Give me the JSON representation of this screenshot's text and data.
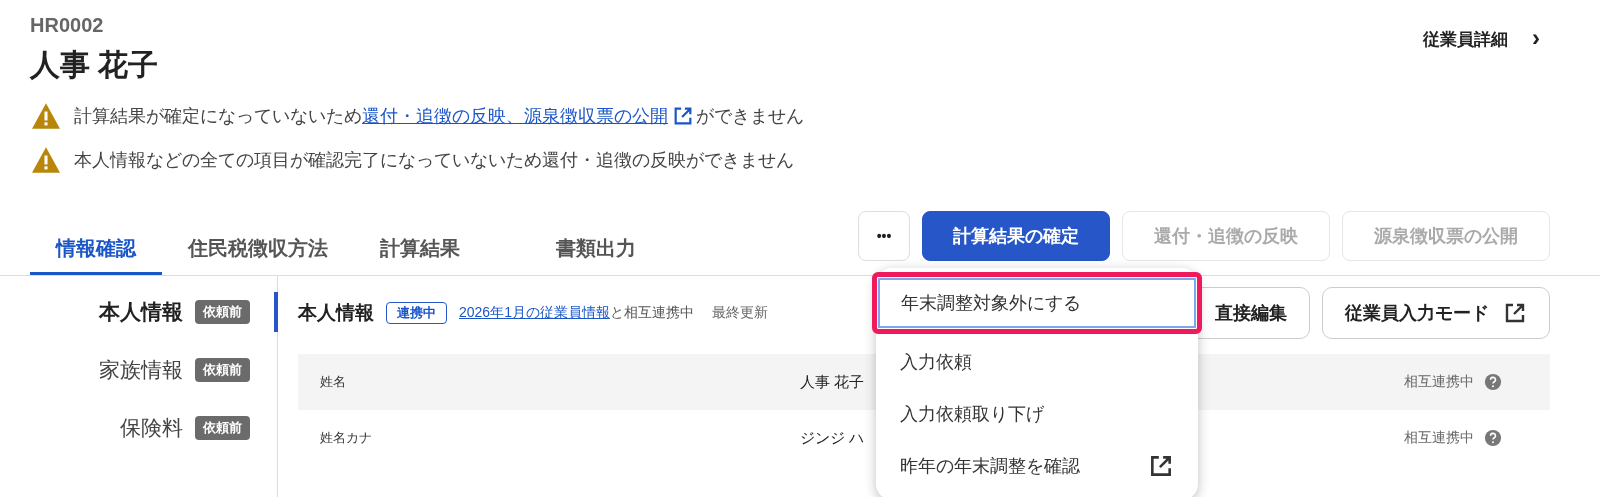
{
  "employee": {
    "code": "HR0002",
    "name": "人事 花子"
  },
  "detail_link": {
    "label": "従業員詳細",
    "arrow": "›"
  },
  "warnings": [
    {
      "before": "計算結果が確定になっていないため",
      "link": "還付・追徴の反映、源泉徴収票の公開",
      "after": "ができません"
    },
    {
      "before": "本人情報などの全ての項目が確認完了になっていないため還付・追徴の反映ができません"
    }
  ],
  "tabs": [
    {
      "label": "情報確認",
      "selected": true
    },
    {
      "label": "住民税徴収方法",
      "selected": false
    },
    {
      "label": "計算結果",
      "selected": false
    },
    {
      "label": "書類出力",
      "selected": false
    }
  ],
  "actions": [
    {
      "label": "•••",
      "kind": "more",
      "disabled": false
    },
    {
      "label": "計算結果の確定",
      "kind": "primary",
      "disabled": false
    },
    {
      "label": "還付・追徴の反映",
      "kind": "secondary",
      "disabled": true
    },
    {
      "label": "源泉徴収票の公開",
      "kind": "secondary",
      "disabled": true
    }
  ],
  "menu": {
    "items": [
      {
        "label": "年末調整対象外にする",
        "highlighted": true,
        "external": false
      },
      {
        "label": "入力依頼",
        "highlighted": false,
        "external": false
      },
      {
        "label": "入力依頼取り下げ",
        "highlighted": false,
        "external": false
      },
      {
        "label": "昨年の年末調整を確認",
        "highlighted": false,
        "external": true
      }
    ]
  },
  "sidebar": {
    "items": [
      {
        "label": "本人情報",
        "badge": "依頼前",
        "selected": true
      },
      {
        "label": "家族情報",
        "badge": "依頼前",
        "selected": false
      },
      {
        "label": "保険料",
        "badge": "依頼前",
        "selected": false
      }
    ]
  },
  "section": {
    "title": "本人情報",
    "status": "連携中",
    "link": "2026年1月の従業員情報",
    "link_suffix": "と相互連携中",
    "updated": "最終更新",
    "buttons": [
      {
        "label": "直接編集",
        "external": false
      },
      {
        "label": "従業員入力モード",
        "external": true
      }
    ]
  },
  "table": {
    "rows": [
      {
        "label": "姓名",
        "value": "人事 花子",
        "status": "相互連携中"
      },
      {
        "label": "姓名カナ",
        "value": "ジンジ ハ",
        "status": "相互連携中"
      }
    ]
  }
}
